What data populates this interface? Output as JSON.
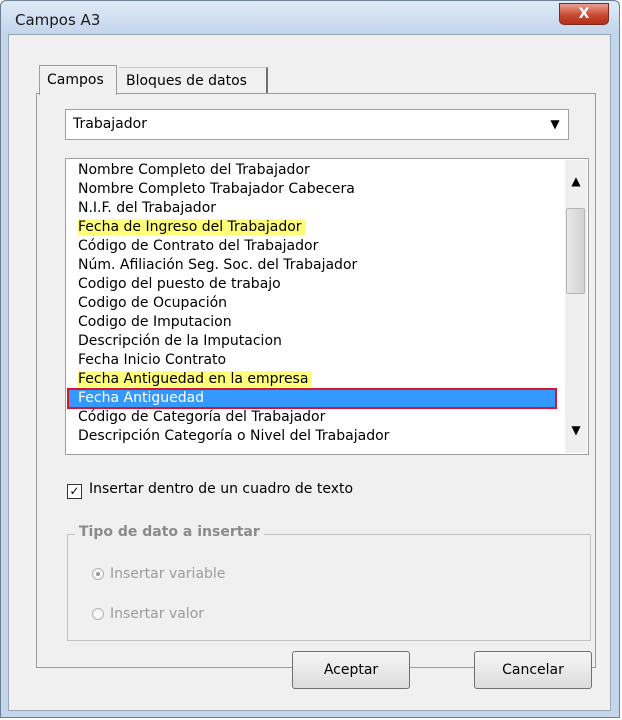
{
  "window": {
    "title": "Campos A3",
    "close_label": "X"
  },
  "tabs": [
    {
      "label": "Campos",
      "active": true
    },
    {
      "label": "Bloques de datos",
      "active": false
    }
  ],
  "category_combo": {
    "value": "Trabajador"
  },
  "fields_list": {
    "items": [
      {
        "label": "Nombre Completo del Trabajador",
        "state": "normal"
      },
      {
        "label": "Nombre Completo Trabajador Cabecera",
        "state": "normal"
      },
      {
        "label": "N.I.F. del Trabajador",
        "state": "normal"
      },
      {
        "label": "Fecha de Ingreso del Trabajador",
        "state": "highlighted"
      },
      {
        "label": "Código de Contrato del Trabajador",
        "state": "normal"
      },
      {
        "label": "Núm. Afiliación Seg. Soc. del Trabajador",
        "state": "normal"
      },
      {
        "label": "Codigo del puesto de trabajo",
        "state": "normal"
      },
      {
        "label": "Codigo de Ocupación",
        "state": "normal"
      },
      {
        "label": "Codigo de Imputacion",
        "state": "normal"
      },
      {
        "label": "Descripción de la Imputacion",
        "state": "normal"
      },
      {
        "label": "Fecha Inicio Contrato",
        "state": "normal"
      },
      {
        "label": "Fecha Antiguedad en la empresa",
        "state": "highlighted"
      },
      {
        "label": "Fecha Antiguedad",
        "state": "selected"
      },
      {
        "label": "Código de Categoría del Trabajador",
        "state": "normal"
      },
      {
        "label": "Descripción Categoría o Nivel del Trabajador",
        "state": "normal"
      }
    ],
    "highlight_color": "#ffff7a",
    "selected_color": "#3399ff",
    "selected_outline_color": "#d8142f"
  },
  "insert_in_textbox": {
    "label": "Insertar dentro de un cuadro de texto",
    "checked": true
  },
  "data_type_group": {
    "legend": "Tipo de dato a insertar",
    "enabled": false,
    "options": [
      {
        "label": "Insertar variable",
        "selected": true
      },
      {
        "label": "Insertar valor",
        "selected": false
      }
    ]
  },
  "buttons": {
    "ok": "Aceptar",
    "cancel": "Cancelar"
  }
}
